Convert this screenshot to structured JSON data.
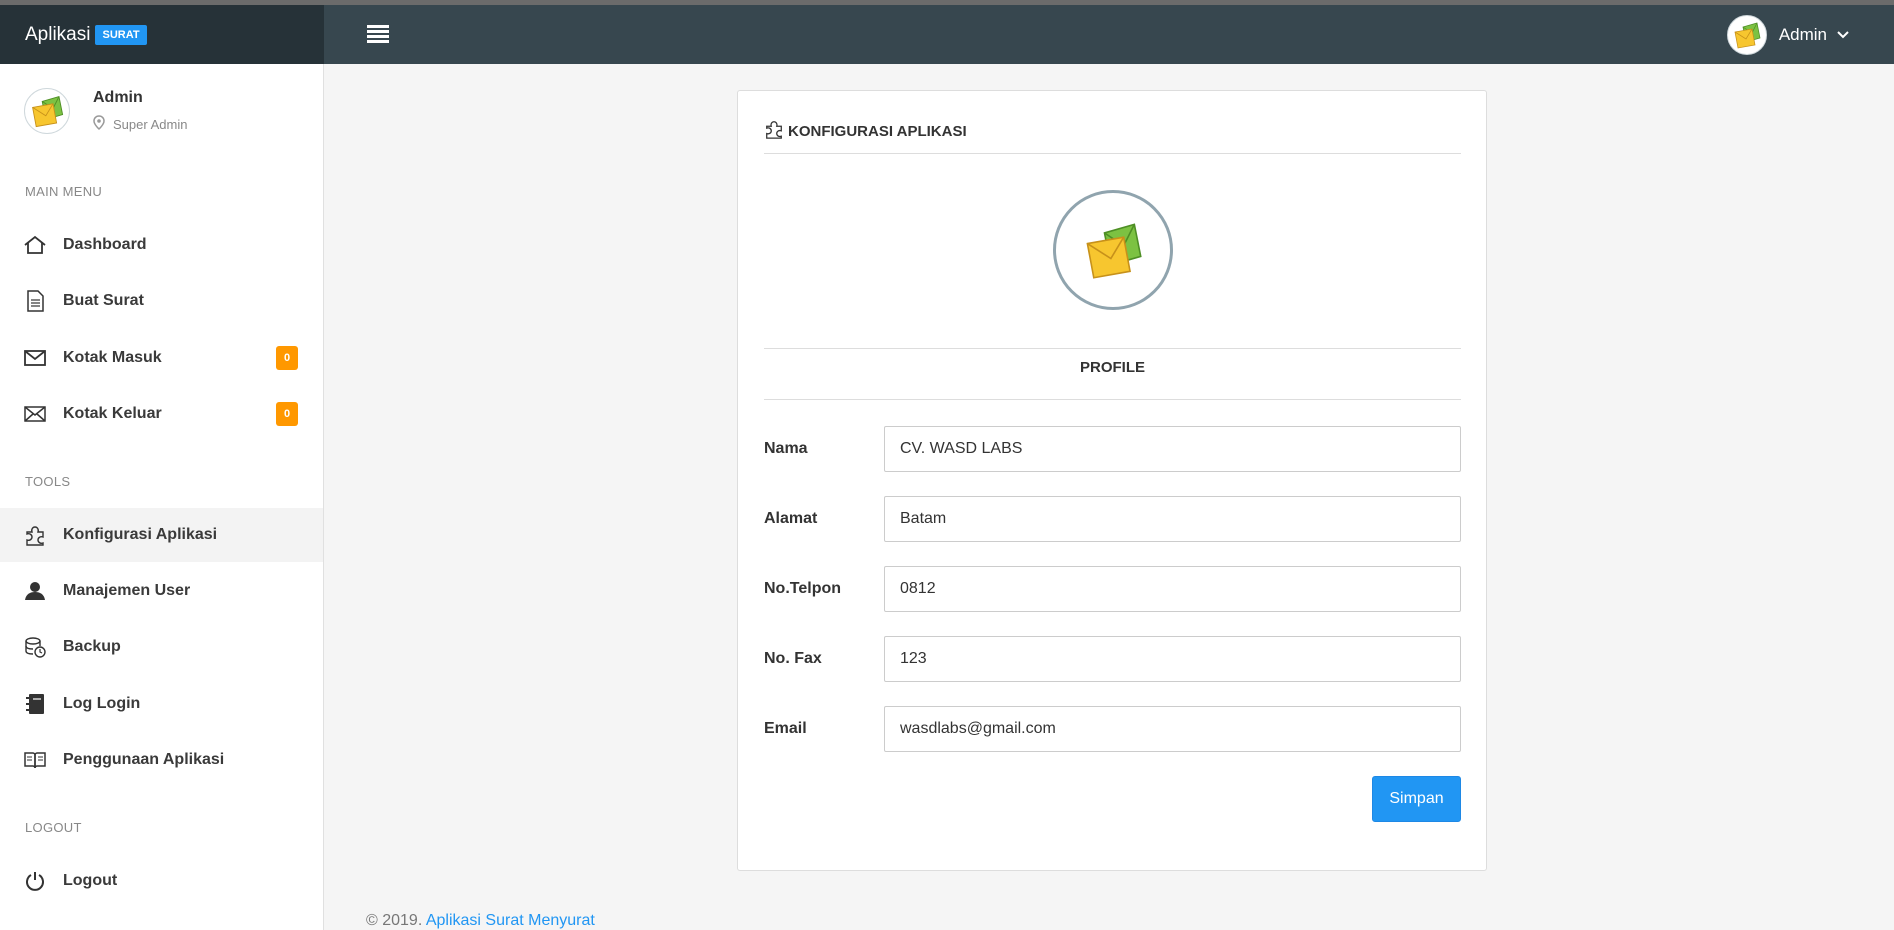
{
  "brand": {
    "text": "Aplikasi",
    "badge": "SURAT"
  },
  "topbar": {
    "user_name": "Admin"
  },
  "sidebar": {
    "profile": {
      "name": "Admin",
      "role": "Super Admin"
    },
    "sections": {
      "main": "MAIN MENU",
      "tools": "TOOLS",
      "logout": "LOGOUT"
    },
    "items": [
      {
        "label": "Dashboard",
        "icon": "home-icon"
      },
      {
        "label": "Buat Surat",
        "icon": "document-icon"
      },
      {
        "label": "Kotak Masuk",
        "icon": "envelope-icon",
        "badge": "0"
      },
      {
        "label": "Kotak Keluar",
        "icon": "envelope-x-icon",
        "badge": "0"
      },
      {
        "label": "Konfigurasi Aplikasi",
        "icon": "puzzle-icon",
        "active": true
      },
      {
        "label": "Manajemen User",
        "icon": "user-icon"
      },
      {
        "label": "Backup",
        "icon": "database-icon"
      },
      {
        "label": "Log Login",
        "icon": "notebook-icon"
      },
      {
        "label": "Penggunaan Aplikasi",
        "icon": "book-icon"
      },
      {
        "label": "Logout",
        "icon": "power-icon"
      }
    ]
  },
  "card": {
    "title": "KONFIGURASI APLIKASI",
    "profile_heading": "PROFILE",
    "fields": [
      {
        "label": "Nama",
        "value": "CV. WASD LABS"
      },
      {
        "label": "Alamat",
        "value": "Batam"
      },
      {
        "label": "No.Telpon",
        "value": "0812"
      },
      {
        "label": "No. Fax",
        "value": "123"
      },
      {
        "label": "Email",
        "value": "wasdlabs@gmail.com"
      }
    ],
    "save_label": "Simpan"
  },
  "footer": {
    "copyright": "© 2019.",
    "link": "Aplikasi Surat Menyurat"
  },
  "colors": {
    "topbar": "#37474f",
    "brand_bg": "#263238",
    "accent": "#2196f3",
    "badge": "#ff9800"
  }
}
